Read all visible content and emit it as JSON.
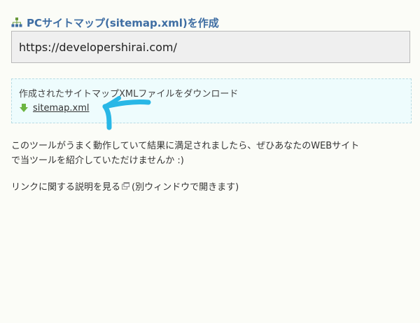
{
  "section": {
    "icon": "sitemap-icon",
    "title": "PCサイトマップ(sitemap.xml)を作成"
  },
  "url_input": {
    "value": "https://developershirai.com/"
  },
  "download": {
    "caption": "作成されたサイトマップXMLファイルをダウンロード",
    "icon": "download-arrow-icon",
    "link_label": "sitemap.xml"
  },
  "annotation": {
    "icon": "hand-drawn-arrow-icon",
    "color": "#29b7e6"
  },
  "message": {
    "line1": "このツールがうまく動作していて結果に満足されましたら、ぜひあなたのWEBサイト",
    "line2": "で当ツールを紹介していただけませんか :)"
  },
  "help": {
    "link_label": "リンクに関する説明を見る",
    "icon": "external-window-icon",
    "suffix": " (別ウィンドウで開きます)"
  },
  "colors": {
    "title": "#3f6ea3",
    "download_box_bg": "#eefcfd",
    "download_icon": "#6cb541"
  }
}
